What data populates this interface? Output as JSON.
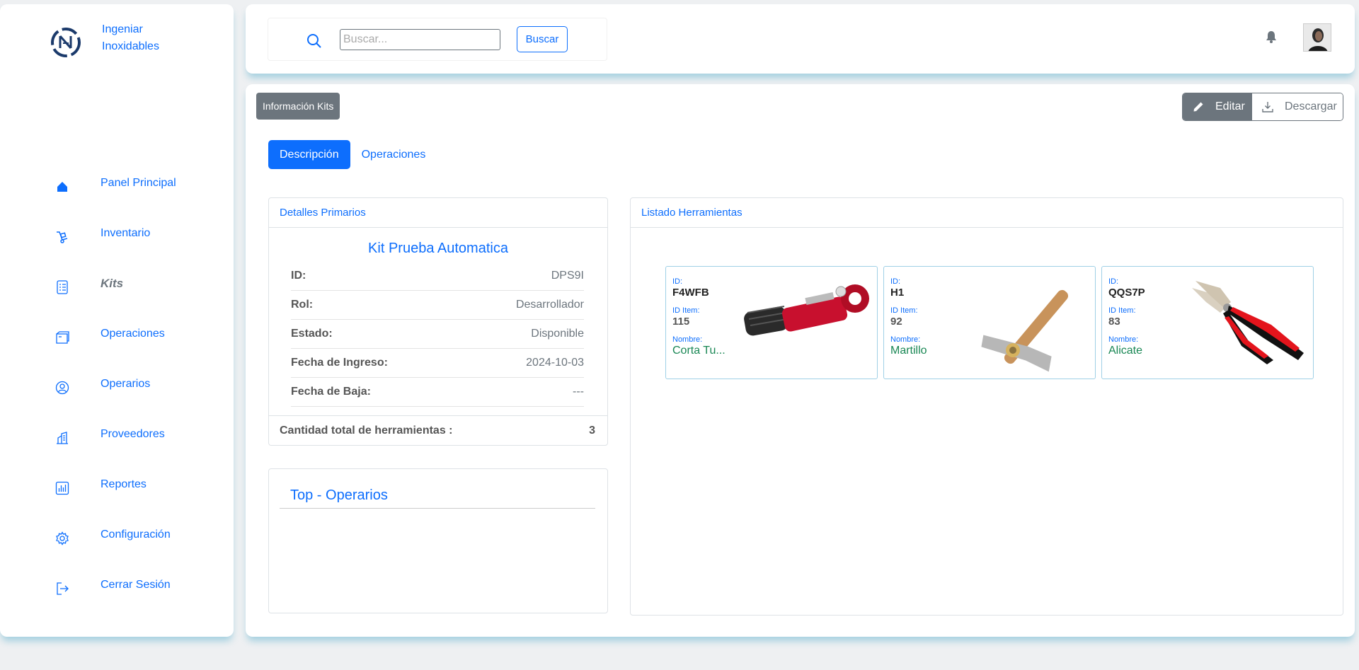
{
  "brand": {
    "name": "Ingeniar Inoxidables"
  },
  "sidebar": {
    "items": [
      {
        "label": "Panel Principal",
        "icon": "home-icon"
      },
      {
        "label": "Inventario",
        "icon": "trolley-icon"
      },
      {
        "label": "Kits",
        "icon": "list-icon",
        "active": true
      },
      {
        "label": "Operaciones",
        "icon": "folder-icon"
      },
      {
        "label": "Operarios",
        "icon": "user-circle-icon"
      },
      {
        "label": "Proveedores",
        "icon": "building-icon"
      },
      {
        "label": "Reportes",
        "icon": "bar-chart-icon"
      },
      {
        "label": "Configuración",
        "icon": "gear-icon"
      },
      {
        "label": "Cerrar Sesión",
        "icon": "logout-icon"
      }
    ]
  },
  "header": {
    "search_placeholder": "Buscar...",
    "search_button": "Buscar"
  },
  "main": {
    "title_badge": "Información Kits",
    "edit_label": "Editar",
    "download_label": "Descargar",
    "tabs": [
      {
        "label": "Descripción",
        "active": true
      },
      {
        "label": "Operaciones",
        "active": false
      }
    ],
    "details": {
      "header": "Detalles Primarios",
      "kit_name": "Kit Prueba Automatica",
      "rows": [
        {
          "key": "ID:",
          "value": "DPS9I"
        },
        {
          "key": "Rol:",
          "value": "Desarrollador"
        },
        {
          "key": "Estado:",
          "value": "Disponible"
        },
        {
          "key": "Fecha de Ingreso:",
          "value": "2024-10-03"
        },
        {
          "key": "Fecha de Baja:",
          "value": "---"
        }
      ],
      "total_label": "Cantidad total de herramientas :",
      "total_value": "3"
    },
    "top_operarios": {
      "title": "Top - Operarios"
    },
    "tools": {
      "header": "Listado Herramientas",
      "id_label": "ID:",
      "item_label": "ID Item:",
      "name_label": "Nombre:",
      "items": [
        {
          "id": "F4WFB",
          "item_id": "115",
          "name": "Corta Tu...",
          "image": "pipe-cutter"
        },
        {
          "id": "H1",
          "item_id": "92",
          "name": "Martillo",
          "image": "hammer"
        },
        {
          "id": "QQS7P",
          "item_id": "83",
          "name": "Alicate",
          "image": "pliers"
        }
      ]
    }
  },
  "colors": {
    "primary": "#0d6efd",
    "secondary": "#6c757d",
    "success": "#198754"
  }
}
